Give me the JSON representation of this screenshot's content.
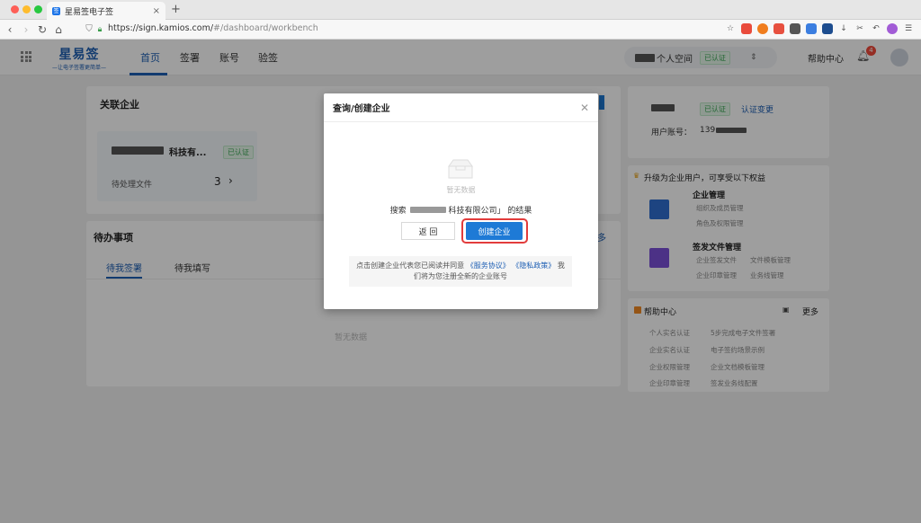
{
  "browser": {
    "tab_title": "星易签电子签",
    "url_host": "https://sign.kamios.com/",
    "url_path": "#/dashboard/workbench"
  },
  "header": {
    "logo_main": "星易签",
    "logo_sub": "—让电子签署更简单—",
    "nav": [
      "首页",
      "签署",
      "账号",
      "验签"
    ],
    "space_label": "个人空间",
    "space_badge": "已认证",
    "help": "帮助中心",
    "notifications": "4"
  },
  "related": {
    "title": "关联企业",
    "company_name": "科技有...",
    "company_badge": "已认证",
    "pending_label": "待处理文件",
    "pending_count": "3"
  },
  "todo": {
    "title": "待办事项",
    "tabs": [
      "待我签署",
      "待我填写"
    ],
    "more": "多",
    "empty": "暂无数据"
  },
  "account": {
    "badge": "已认证",
    "change": "认证变更",
    "phone_label": "用户账号：",
    "phone_value": "139"
  },
  "upgrade": {
    "title": "升级为企业用户，可享受以下权益",
    "enterprise_title": "企业管理",
    "enterprise_items": [
      "组织及成员管理",
      "角色及权限管理"
    ],
    "doc_title": "签发文件管理",
    "doc_items": [
      "企业签发文件",
      "文件模板管理",
      "企业印章管理",
      "业务线管理"
    ]
  },
  "helpcenter": {
    "title": "帮助中心",
    "more": "更多",
    "links": [
      "个人实名认证",
      "5步完成电子文件签署",
      "企业实名认证",
      "电子签约场景示例",
      "企业权限管理",
      "企业文档模板管理",
      "企业印章管理",
      "签发业务线配置"
    ]
  },
  "modal": {
    "title": "查询/创建企业",
    "empty": "暂无数据",
    "search_prefix": "搜索",
    "search_company": "科技有限公司」",
    "search_suffix": "的结果",
    "back": "返 回",
    "create": "创建企业",
    "notice_1": "点击创建企业代表您已阅读并同意",
    "notice_link1": "《服务协议》",
    "notice_link2": "《隐私政策》",
    "notice_2": "我",
    "notice_3": "们将为您注册全新的企业账号"
  },
  "colors": {
    "brand": "#1e5fb4",
    "primary_button": "#1e7ad6",
    "highlight": "#e23c3c",
    "success": "#3aa655"
  }
}
